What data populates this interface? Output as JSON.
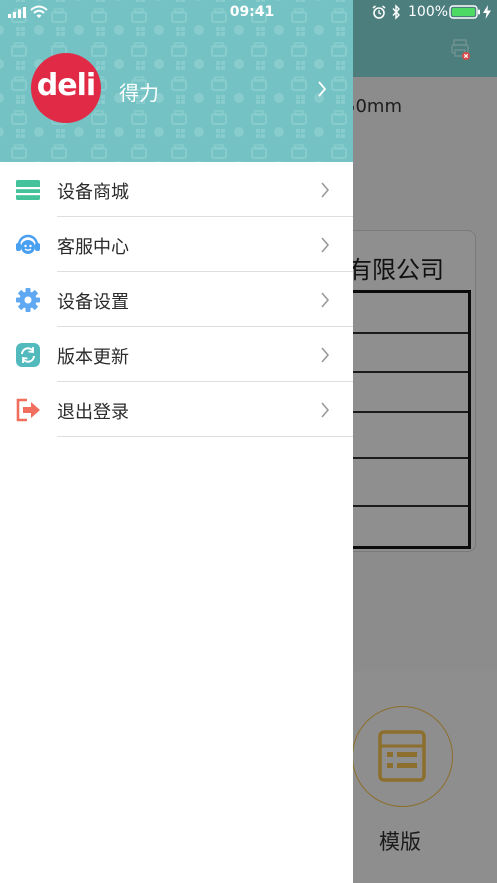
{
  "status_bar": {
    "time": "09:41",
    "battery_percent": "100%"
  },
  "background_screen": {
    "size_label": "50mm",
    "company_text": "有限公司",
    "template_label": "模版"
  },
  "drawer": {
    "logo_text": "deli",
    "user_name": "得力",
    "menu": [
      {
        "label": "设备商城",
        "icon": "store-icon"
      },
      {
        "label": "客服中心",
        "icon": "customer-service-icon"
      },
      {
        "label": "设备设置",
        "icon": "settings-gear-icon"
      },
      {
        "label": "版本更新",
        "icon": "update-icon"
      },
      {
        "label": "退出登录",
        "icon": "logout-icon"
      }
    ]
  },
  "colors": {
    "drawer_header": "#74c2c3",
    "logo_red": "#e02a46",
    "store_icon": "#44c29a",
    "service_icon": "#4aa0f0",
    "gear_icon": "#5ea9f2",
    "update_icon": "#52b9bd",
    "logout_icon": "#ef6e5e"
  }
}
